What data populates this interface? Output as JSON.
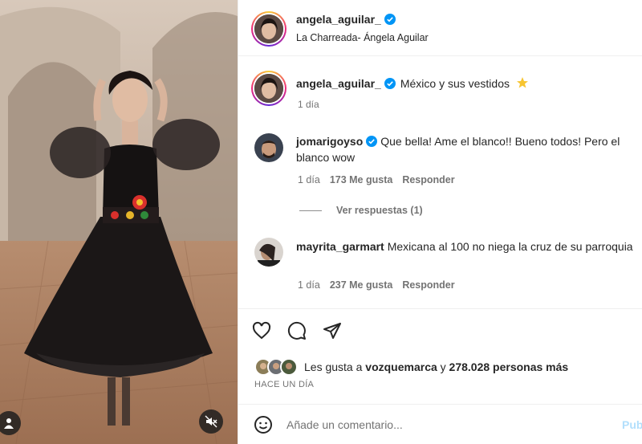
{
  "post": {
    "author": "angela_aguilar_",
    "audio_subtitle": "La Charreada- Ángela Aguilar",
    "caption_text": "México y sus vestidos",
    "caption_time": "1 día",
    "like_summary_prefix": "Les gusta a",
    "like_summary_user": "vozquemarca",
    "like_summary_mid": "y",
    "like_summary_count": "278.028 personas más",
    "posted_when": "HACE UN DÍA"
  },
  "comments": [
    {
      "username": "jomarigoyso",
      "verified": true,
      "text": "Que bella! Ame el blanco!! Bueno todos! Pero el blanco wow",
      "time": "1 día",
      "likes": "173 Me gusta",
      "reply_label": "Responder",
      "replies_label": "Ver respuestas (1)"
    },
    {
      "username": "mayrita_garmart",
      "verified": false,
      "text": "Mexicana al 100 no niega la cruz de su parroquia",
      "time": "1 día",
      "likes": "237 Me gusta",
      "reply_label": "Responder"
    }
  ],
  "composer": {
    "placeholder": "Añade un comentario...",
    "publish_label": "Publ"
  },
  "icons": {
    "verified": "verified-badge-icon",
    "star": "star-emoji-icon",
    "like": "heart-icon",
    "comment": "comment-bubble-icon",
    "share": "paper-plane-icon",
    "emoji": "smiley-icon",
    "user_tag": "user-tag-icon",
    "mute": "speaker-muted-icon"
  },
  "colors": {
    "verified_blue": "#0095f6",
    "publish_disabled": "#b2dffc",
    "secondary_text": "#737373"
  }
}
